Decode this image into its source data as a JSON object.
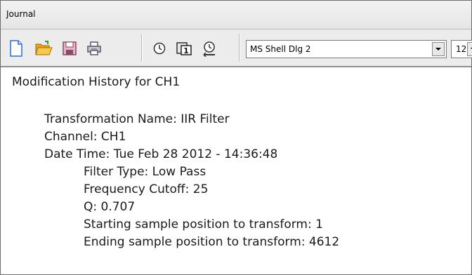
{
  "window": {
    "title": "Journal"
  },
  "toolbar": {
    "buttons": [
      {
        "name": "new",
        "icon": "new-document-icon"
      },
      {
        "name": "open",
        "icon": "folder-open-icon"
      },
      {
        "name": "save",
        "icon": "save-disk-icon"
      },
      {
        "name": "print",
        "icon": "printer-icon"
      },
      {
        "name": "timestamp",
        "icon": "clock-icon"
      },
      {
        "name": "channel",
        "icon": "channel-1-icon"
      },
      {
        "name": "history",
        "icon": "history-icon"
      }
    ],
    "font_name": "MS Shell Dlg 2",
    "font_size": "12"
  },
  "journal": {
    "heading": "Modification History for CH1",
    "transformation": "Transformation Name: IIR Filter",
    "channel": "Channel: CH1",
    "datetime": "Date Time: Tue Feb 28 2012 - 14:36:48",
    "filter_type": "Filter Type: Low Pass",
    "cutoff": "Frequency Cutoff: 25",
    "q": "Q: 0.707",
    "start_pos": "Starting sample position to transform: 1",
    "end_pos": "Ending sample position to transform: 4612"
  }
}
